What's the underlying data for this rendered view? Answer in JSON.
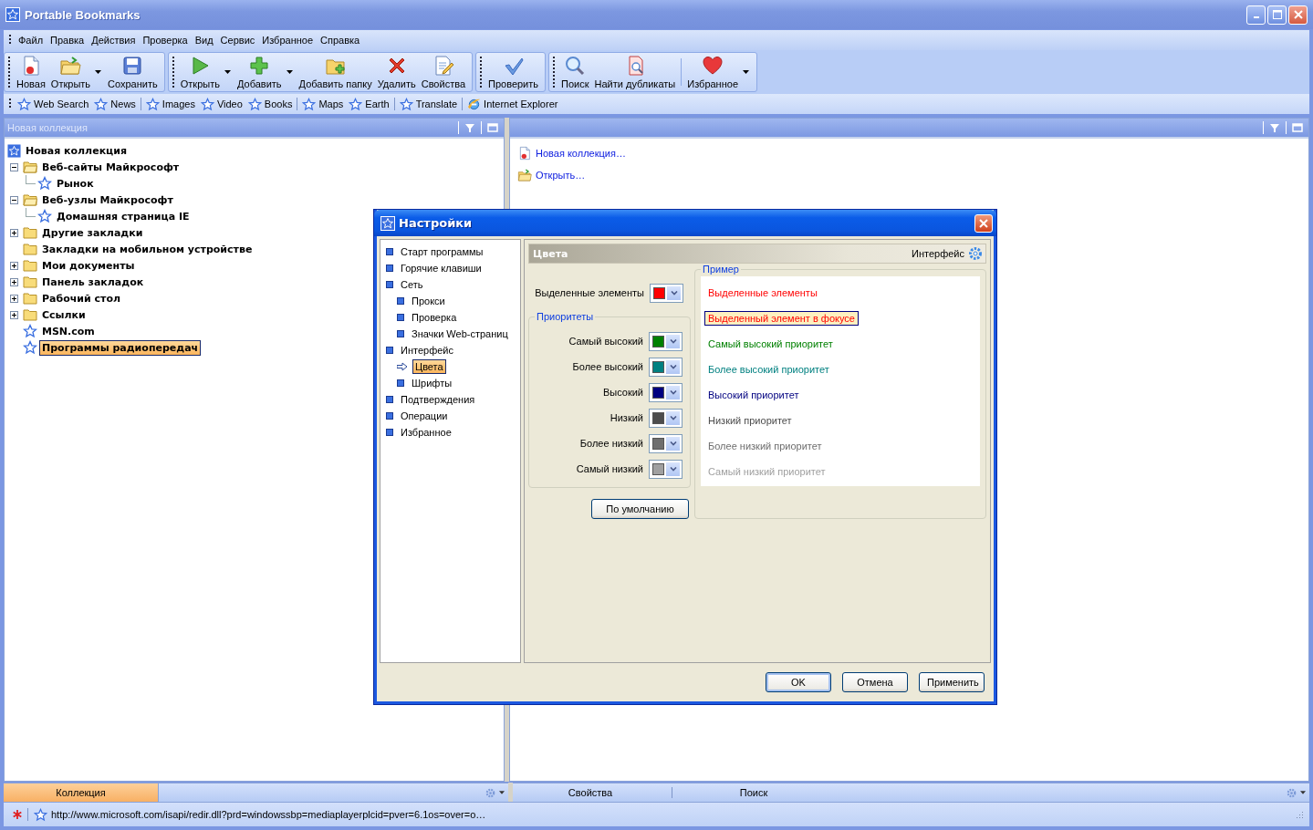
{
  "window": {
    "title": "Portable Bookmarks"
  },
  "menu": [
    "Файл",
    "Правка",
    "Действия",
    "Проверка",
    "Вид",
    "Сервис",
    "Избранное",
    "Справка"
  ],
  "toolbar": [
    [
      {
        "label": "Новая",
        "kind": "new",
        "dropdown": false
      },
      {
        "label": "Открыть",
        "kind": "open",
        "dropdown": true
      },
      {
        "label": "Сохранить",
        "kind": "save",
        "dropdown": false
      }
    ],
    [
      {
        "label": "Открыть",
        "kind": "play",
        "dropdown": true
      },
      {
        "label": "Добавить",
        "kind": "add",
        "dropdown": true
      },
      {
        "label": "Добавить папку",
        "kind": "addfolder",
        "dropdown": false
      },
      {
        "label": "Удалить",
        "kind": "delete",
        "dropdown": false
      },
      {
        "label": "Свойства",
        "kind": "props",
        "dropdown": false
      }
    ],
    [
      {
        "label": "Проверить",
        "kind": "check",
        "dropdown": false
      }
    ],
    [
      {
        "label": "Поиск",
        "kind": "search",
        "dropdown": false
      },
      {
        "label": "Найти дубликаты",
        "kind": "dupes",
        "dropdown": false
      },
      {
        "label": "Избранное",
        "kind": "fav",
        "dropdown": true
      }
    ]
  ],
  "links_bar": [
    [
      {
        "label": "Web Search",
        "kind": "star"
      },
      {
        "label": "News",
        "kind": "star"
      }
    ],
    [
      {
        "label": "Images",
        "kind": "star"
      },
      {
        "label": "Video",
        "kind": "star"
      },
      {
        "label": "Books",
        "kind": "star"
      }
    ],
    [
      {
        "label": "Maps",
        "kind": "star"
      },
      {
        "label": "Earth",
        "kind": "star"
      }
    ],
    [
      {
        "label": "Translate",
        "kind": "star"
      }
    ],
    [
      {
        "label": "Internet Explorer",
        "kind": "ie"
      }
    ]
  ],
  "left_panel": {
    "title": "Новая коллекция",
    "tree": [
      {
        "label": "Новая коллекция",
        "kind": "collection",
        "selected": false,
        "children": [
          {
            "label": "Веб-сайты Майкрософт",
            "kind": "folder",
            "expanded": true,
            "selected": false,
            "children": [
              {
                "label": "Рынок",
                "kind": "link",
                "selected": false
              }
            ]
          },
          {
            "label": "Веб-узлы Майкрософт",
            "kind": "folder",
            "expanded": true,
            "selected": false,
            "children": [
              {
                "label": "Домашняя страница IE",
                "kind": "link",
                "selected": false
              }
            ]
          },
          {
            "label": "Другие закладки",
            "kind": "folder",
            "expanded": false,
            "selected": false
          },
          {
            "label": "Закладки на мобильном устройстве",
            "kind": "folder",
            "selected": false
          },
          {
            "label": "Мои документы",
            "kind": "folder",
            "expanded": false,
            "selected": false
          },
          {
            "label": "Панель закладок",
            "kind": "folder",
            "expanded": false,
            "selected": false
          },
          {
            "label": "Рабочий стол",
            "kind": "folder",
            "expanded": false,
            "selected": false
          },
          {
            "label": "Ссылки",
            "kind": "folder",
            "expanded": false,
            "selected": false
          },
          {
            "label": "MSN.com",
            "kind": "link",
            "selected": false
          },
          {
            "label": "Программы радиопередач",
            "kind": "link",
            "selected": true
          }
        ]
      }
    ]
  },
  "right_panel": {
    "actions": [
      {
        "label": "Новая коллекция…",
        "kind": "new"
      },
      {
        "label": "Открыть…",
        "kind": "open"
      }
    ]
  },
  "left_tabs": [
    {
      "label": "Коллекция",
      "selected": true
    }
  ],
  "right_tabs": [
    {
      "label": "Свойства",
      "selected": false
    },
    {
      "label": "Поиск",
      "selected": false
    }
  ],
  "status_bar": {
    "url": "http://www.microsoft.com/isapi/redir.dll?prd=windowssbp=mediaplayerplcid=pver=6.1os=over=o…"
  },
  "dialog": {
    "title": "Настройки",
    "nav": [
      {
        "label": "Старт программы",
        "selected": false
      },
      {
        "label": "Горячие клавиши",
        "selected": false
      },
      {
        "label": "Сеть",
        "selected": false,
        "children": [
          {
            "label": "Прокси",
            "selected": false
          },
          {
            "label": "Проверка",
            "selected": false
          },
          {
            "label": "Значки Web-страниц",
            "selected": false
          }
        ]
      },
      {
        "label": "Интерфейс",
        "selected": false,
        "children": [
          {
            "label": "Цвета",
            "selected": true
          },
          {
            "label": "Шрифты",
            "selected": false
          }
        ]
      },
      {
        "label": "Подтверждения",
        "selected": false
      },
      {
        "label": "Операции",
        "selected": false
      },
      {
        "label": "Избранное",
        "selected": false
      }
    ],
    "section": {
      "title": "Цвета",
      "breadcrumb": "Интерфейс"
    },
    "highlight": {
      "label": "Выделенные элементы",
      "color": "#ff0000"
    },
    "priorities": {
      "title": "Приоритеты",
      "items": [
        {
          "label": "Самый высокий",
          "color": "#008000"
        },
        {
          "label": "Более высокий",
          "color": "#008080"
        },
        {
          "label": "Высокий",
          "color": "#000080"
        },
        {
          "label": "Низкий",
          "color": "#4d4d4d"
        },
        {
          "label": "Более низкий",
          "color": "#6e6e6e"
        },
        {
          "label": "Самый низкий",
          "color": "#a0a0a0"
        }
      ]
    },
    "preview": {
      "title": "Пример",
      "items": [
        {
          "label": "Выделенные элементы",
          "kind": "plain",
          "color": "#ff0000"
        },
        {
          "label": "Выделенный элемент в фокусе",
          "kind": "focused",
          "color": "#ff0000"
        },
        {
          "label": "Самый высокий приоритет",
          "kind": "plain",
          "color": "#008000"
        },
        {
          "label": "Более высокий приоритет",
          "kind": "plain",
          "color": "#008080"
        },
        {
          "label": "Высокий приоритет",
          "kind": "plain",
          "color": "#000080"
        },
        {
          "label": "Низкий приоритет",
          "kind": "plain",
          "color": "#4d4d4d"
        },
        {
          "label": "Более низкий приоритет",
          "kind": "plain",
          "color": "#6e6e6e"
        },
        {
          "label": "Самый низкий приоритет",
          "kind": "plain",
          "color": "#a0a0a0"
        }
      ]
    },
    "default_button": "По умолчанию",
    "buttons": [
      {
        "label": "OK",
        "kind": "default"
      },
      {
        "label": "Отмена",
        "kind": "normal"
      },
      {
        "label": "Применить",
        "kind": "normal"
      }
    ]
  }
}
